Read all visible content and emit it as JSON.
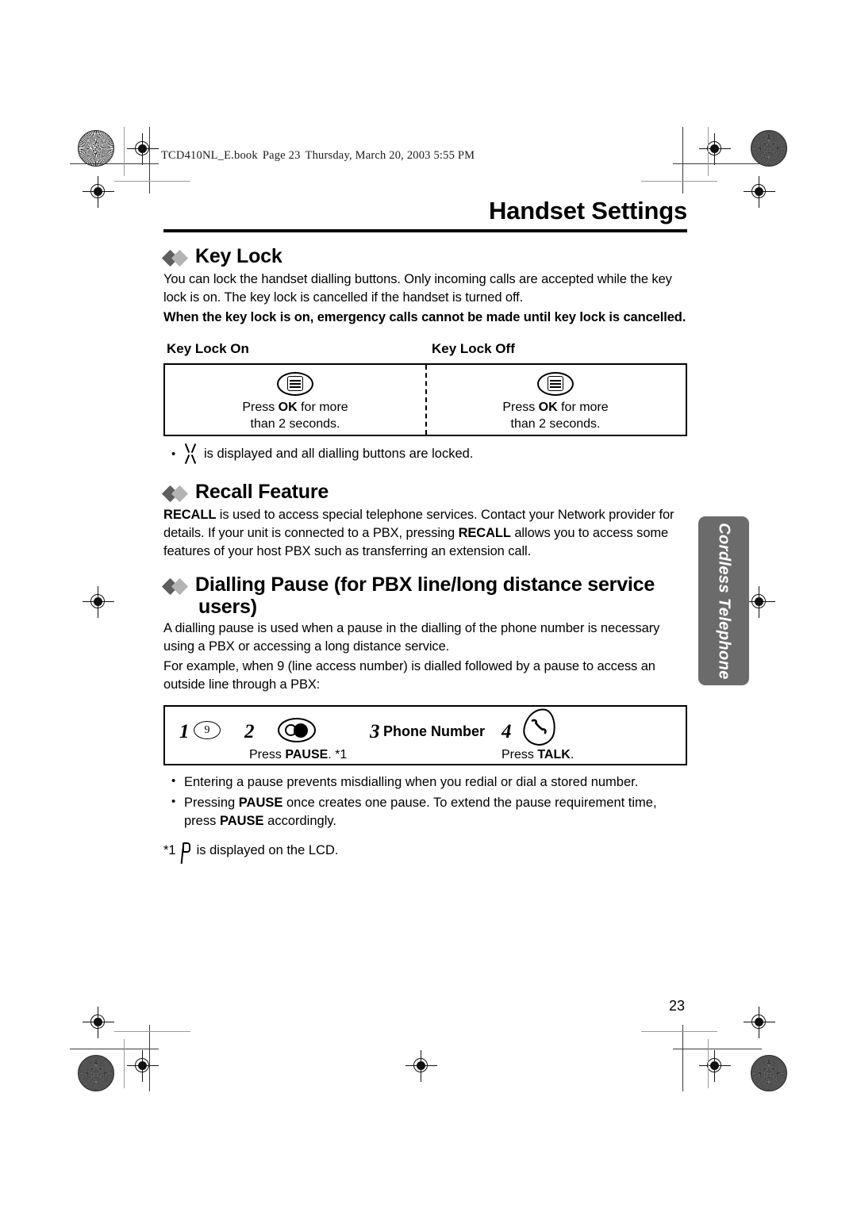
{
  "file_header": {
    "filename": "TCD410NL_E.book",
    "page": "Page 23",
    "timestamp": "Thursday, March 20, 2003  5:55 PM"
  },
  "page_title": "Handset Settings",
  "page_number": "23",
  "side_tab": {
    "label": "Cordless Telephone"
  },
  "sections": {
    "key_lock": {
      "heading": "Key Lock",
      "para1": "You can lock the handset dialling buttons. Only incoming calls are accepted while the key lock is on. The key lock is cancelled if the handset is turned off.",
      "para2_bold": "When the key lock is on, emergency calls cannot be made until key lock is cancelled.",
      "table": {
        "col1_label": "Key Lock On",
        "col2_label": "Key Lock Off",
        "cells": [
          {
            "icon": "ok-softkey-icon",
            "caption_line1_pre": "Press ",
            "caption_line1_bold": "OK",
            "caption_line1_post": " for more",
            "caption_line2": "than 2 seconds."
          },
          {
            "icon": "ok-softkey-icon",
            "caption_line1_pre": "Press ",
            "caption_line1_bold": "OK",
            "caption_line1_post": " for more",
            "caption_line2": "than 2 seconds."
          }
        ]
      },
      "note": "is displayed and all dialling buttons are locked."
    },
    "recall_feature": {
      "heading": "Recall Feature",
      "para_part1_bold": "RECALL",
      "para_part2": " is used to access special telephone services. Contact your Network provider for details. If your unit is connected to a PBX, pressing ",
      "para_part3_bold": "RECALL",
      "para_part4": " allows you to access some features of your host PBX such as transferring an extension call."
    },
    "dialling_pause": {
      "heading_line1": "Dialling Pause (for PBX line/long distance service",
      "heading_line2": "users)",
      "para1": "A dialling pause is used when a pause in the dialling of the phone number is necessary using a PBX or accessing a long distance service.",
      "para2": "For example, when 9 (line access number) is dialled followed by a pause to access an outside line through a PBX:",
      "steps": [
        {
          "num": "1",
          "icon": "digit-9-key-icon",
          "icon_text": "9",
          "caption": ""
        },
        {
          "num": "2",
          "icon": "pause-key-icon",
          "caption_pre": "Press ",
          "caption_bold": "PAUSE",
          "caption_post": ". *1"
        },
        {
          "num": "3",
          "label": "Phone Number",
          "caption": ""
        },
        {
          "num": "4",
          "icon": "talk-key-icon",
          "caption_pre": "Press ",
          "caption_bold": "TALK",
          "caption_post": "."
        }
      ],
      "bullets": [
        {
          "pre": "Entering a pause prevents misdialling when you redial or dial a stored number.",
          "bold": "",
          "post": ""
        },
        {
          "pre": "Pressing ",
          "bold": "PAUSE",
          "mid": " once creates one pause. To extend the pause requirement time, press ",
          "bold2": "PAUSE",
          "post": " accordingly."
        }
      ],
      "footnote_marker": "*1",
      "footnote_text": "is displayed on the LCD."
    }
  }
}
